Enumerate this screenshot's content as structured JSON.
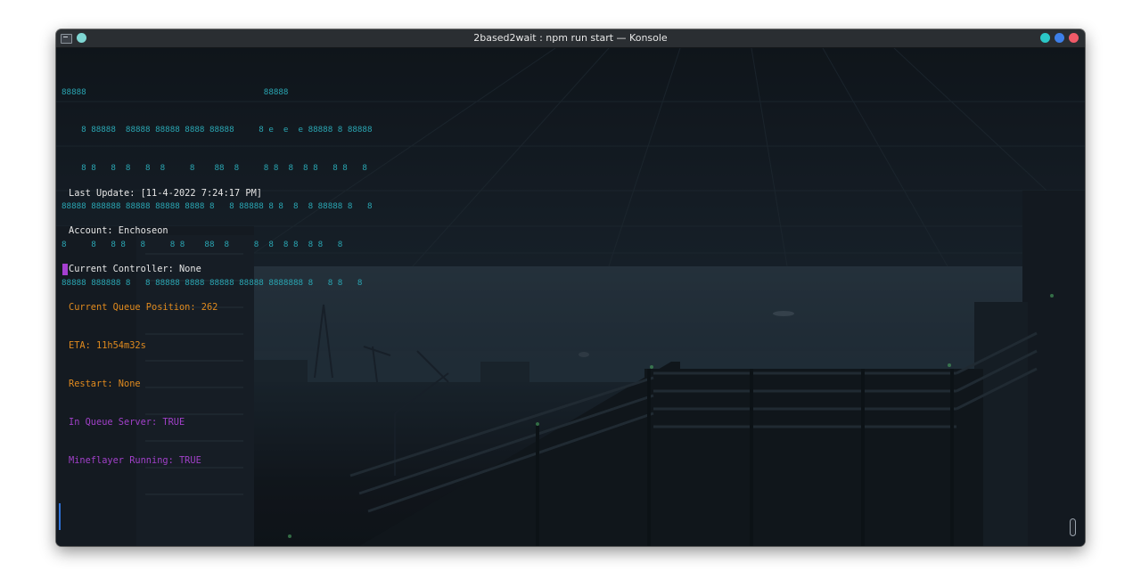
{
  "window": {
    "title": "2based2wait : npm run start — Konsole",
    "controls": [
      "minimize-icon",
      "maximize-icon",
      "close-icon"
    ]
  },
  "terminal": {
    "banner_lines": [
      "88888                                    88888",
      "    8 88888  88888 88888 8888 88888     8 e  e  e 88888 8 88888",
      "    8 8   8  8   8  8     8    88  8     8 8  8  8 8   8 8   8",
      "88888 888888 88888 88888 8888 8   8 88888 8 8  8  8 88888 8   8",
      "8     8   8 8   8     8 8    88  8     8  8  8 8  8 8   8",
      "88888 888888 8   8 88888 8888 88888 88888 8888888 8   8 8   8"
    ],
    "status": {
      "last_update": "Last Update: [11-4-2022 7:24:17 PM]",
      "account": "Account: Enchoseon",
      "controller": "Current Controller: None",
      "queue_position": "Current Queue Position: 262",
      "eta": "ETA: 11h54m32s",
      "restart": "Restart: None",
      "in_queue_server": "In Queue Server: TRUE",
      "mineflayer_running": "Mineflayer Running: TRUE"
    }
  },
  "colors": {
    "banner": "#2aa6b3",
    "default_text": "#e6e6e6",
    "orange_text": "#e08a1e",
    "purple_text": "#a040c8",
    "cursor": "#a63fd1",
    "titlebar": "#2a2e32"
  }
}
